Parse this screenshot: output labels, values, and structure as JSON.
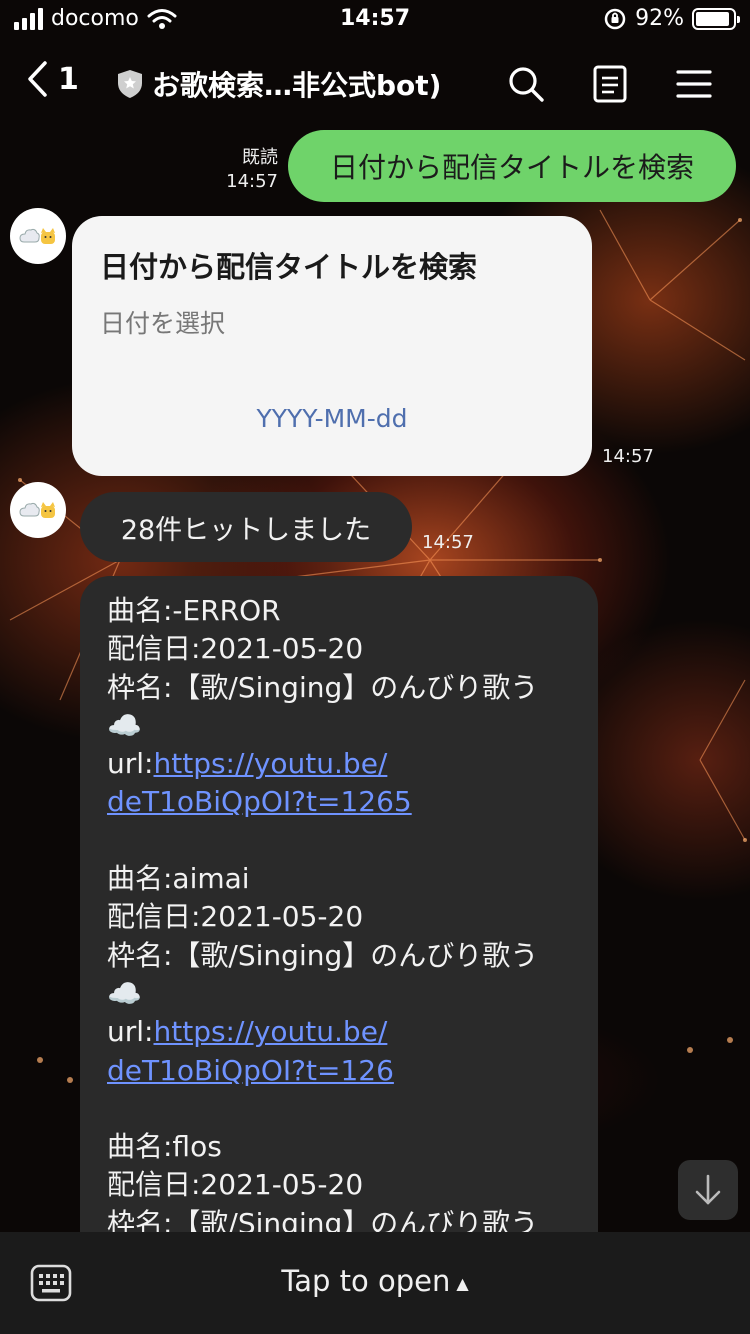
{
  "status_bar": {
    "carrier": "docomo",
    "time": "14:57",
    "battery_percent": "92%",
    "battery_level": 0.92
  },
  "header": {
    "back_count": "1",
    "title": "お歌検索…非公式bot)",
    "icons": [
      "back-chevron-icon",
      "shield-icon",
      "search-icon",
      "notes-icon",
      "menu-icon"
    ]
  },
  "messages": {
    "sent": {
      "read_label": "既読",
      "time": "14:57",
      "text": "日付から配信タイトルを検索"
    },
    "card": {
      "title": "日付から配信タイトルを検索",
      "subtitle": "日付を選択",
      "link": "YYYY-MM-dd",
      "time": "14:57"
    },
    "hits": {
      "text": "28件ヒットしました",
      "time": "14:57"
    },
    "results": [
      {
        "song": "曲名:-ERROR",
        "date": "配信日:2021-05-20",
        "frame1": "枠名:【歌/Singing】のんびり歌う",
        "frame2": "☁️",
        "url_label": "url:",
        "url1": "https://youtu.be/",
        "url2": "deT1oBiQpOI?t=1265"
      },
      {
        "song": "曲名:aimai",
        "date": "配信日:2021-05-20",
        "frame1": "枠名:【歌/Singing】のんびり歌う",
        "frame2": "☁️",
        "url_label": "url:",
        "url1": "https://youtu.be/",
        "url2": "deT1oBiQpOI?t=126"
      },
      {
        "song": "曲名:flos",
        "date": "配信日:2021-05-20",
        "frame1": "枠名:【歌/Singing】のんびり歌う"
      }
    ]
  },
  "bottom_bar": {
    "tap_label": "Tap to open",
    "arrow": "▲"
  },
  "colors": {
    "sent_bubble": "#6fd36a",
    "link": "#6f93ff",
    "card_link": "#4f6fae"
  }
}
